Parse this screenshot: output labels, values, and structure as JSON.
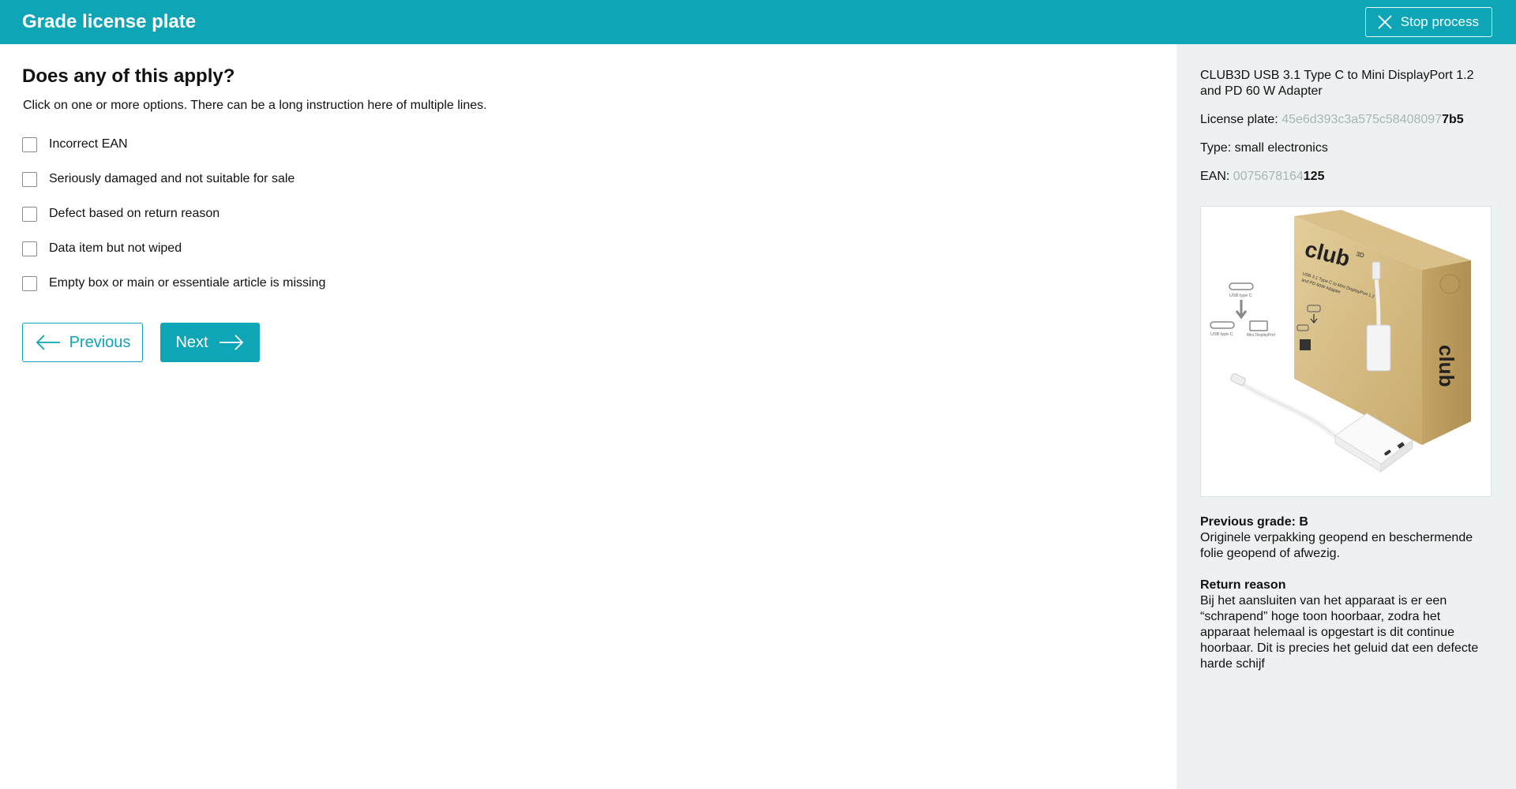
{
  "header": {
    "title": "Grade license plate",
    "stop_label": "Stop process"
  },
  "question": {
    "title": "Does any of this apply?",
    "instruction": "Click on one or more options. There can be a long instruction here of multiple lines.",
    "options": [
      {
        "label": "Incorrect EAN",
        "checked": false
      },
      {
        "label": "Seriously damaged and not suitable for sale",
        "checked": false
      },
      {
        "label": "Defect based on return reason",
        "checked": false
      },
      {
        "label": "Data item but not wiped",
        "checked": false
      },
      {
        "label": "Empty box or main or essentiale article is missing",
        "checked": false
      }
    ]
  },
  "nav": {
    "previous_label": "Previous",
    "next_label": "Next"
  },
  "product": {
    "name": "CLUB3D USB 3.1 Type C to Mini DisplayPort 1.2 and PD 60 W Adapter",
    "license_plate_label": "License plate: ",
    "license_plate_prefix": "45e6d393c3a575c58408097",
    "license_plate_suffix": "7b5",
    "type_label": "Type: ",
    "type_value": "small electronics",
    "ean_label": "EAN: ",
    "ean_prefix": "0075678164",
    "ean_suffix": "125",
    "image_text": {
      "brand": "club",
      "brand_sup": "3D",
      "box_line1": "USB 3.1 Type C to Mini DisplayPort 1.2",
      "box_line2": "and PD 60W Adapter",
      "port_label_top": "USB type C",
      "port_label_left": "USB type C",
      "port_label_right": "Mini DisplayPort"
    }
  },
  "previous_grade": {
    "title": "Previous grade: B",
    "body": "Originele verpakking geopend en beschermende folie geopend of afwezig."
  },
  "return_reason": {
    "title": "Return reason",
    "body": "Bij het aansluiten van het apparaat is er een “schrapend” hoge toon hoorbaar, zodra het apparaat helemaal is opgestart is dit continue hoorbaar. Dit is precies het geluid dat een defecte harde schijf"
  },
  "colors": {
    "accent": "#0ea5b7",
    "sidebar_bg": "#edf1f1",
    "faded_text": "#aab2b6"
  },
  "icons": {
    "stop": "close-icon",
    "previous": "arrow-left-icon",
    "next": "arrow-right-icon"
  }
}
